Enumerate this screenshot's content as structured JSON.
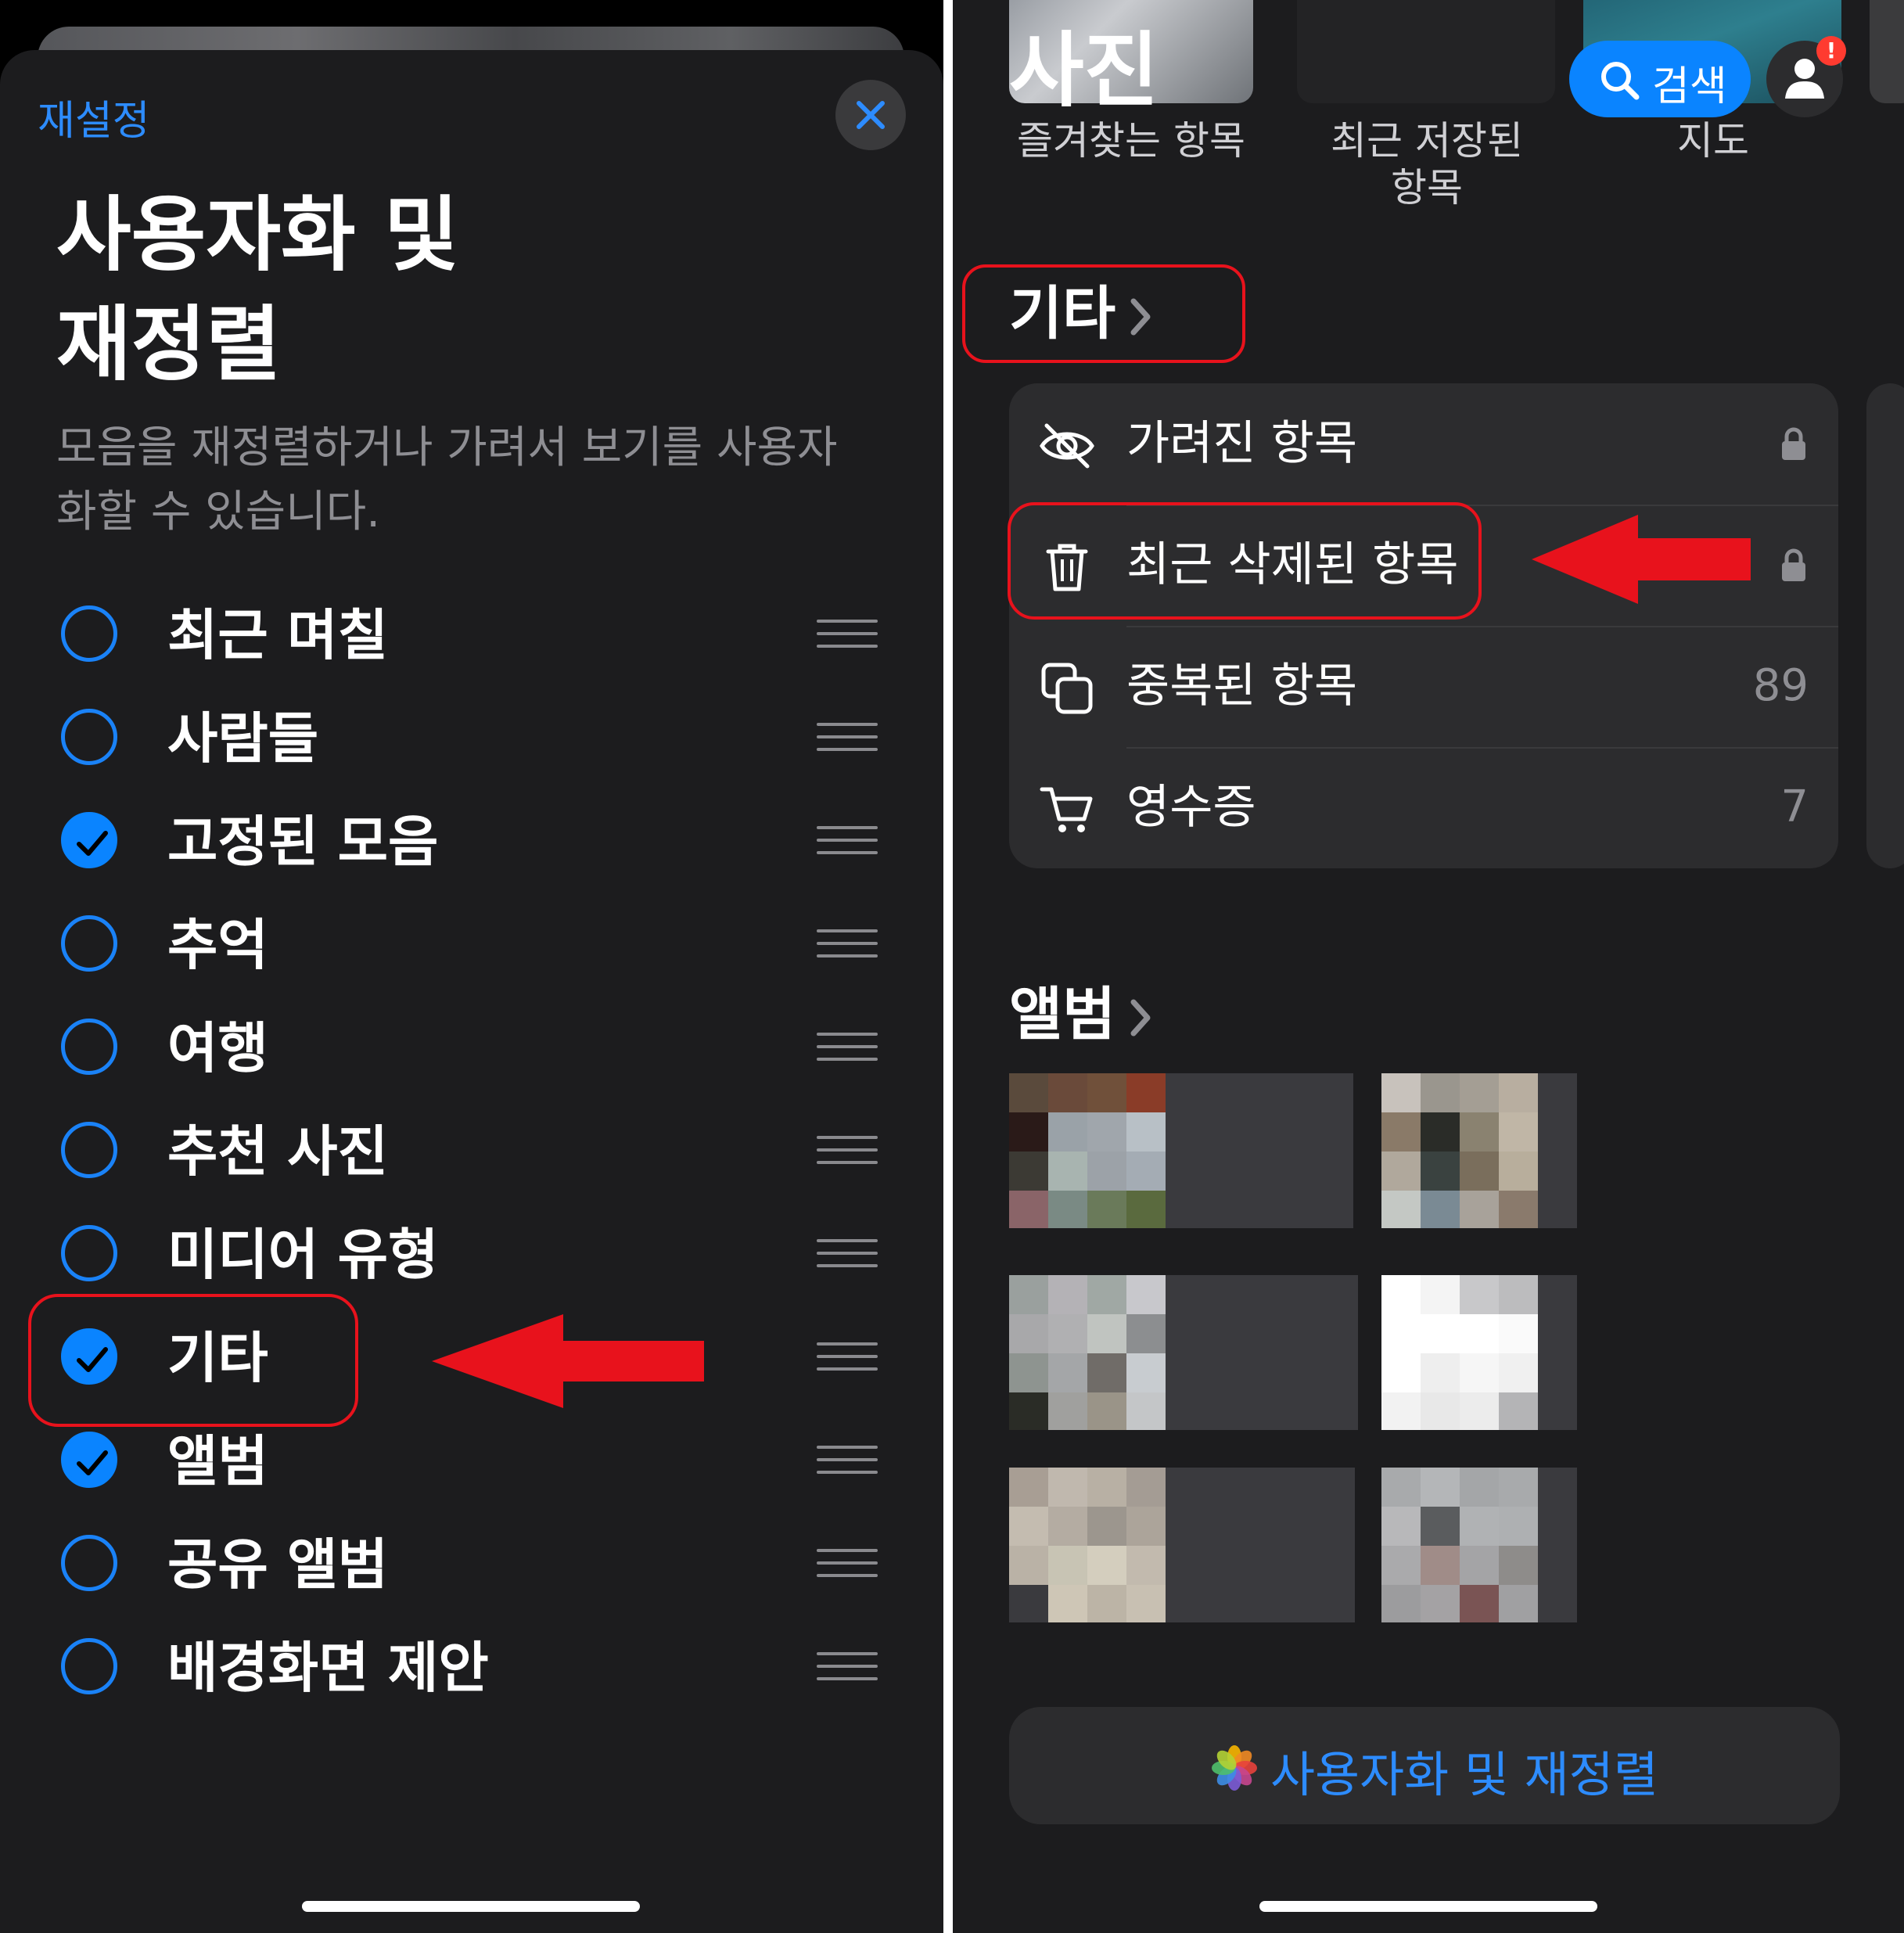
{
  "left": {
    "reset_label": "재설정",
    "close_icon": "close-icon",
    "title": "사용자화 및\n재정렬",
    "description": "모음을 재정렬하거나 가려서 보기를 사용자화할 수 있습니다.",
    "items": [
      {
        "label": "최근 며칠",
        "checked": false
      },
      {
        "label": "사람들",
        "checked": false
      },
      {
        "label": "고정된 모음",
        "checked": true
      },
      {
        "label": "추억",
        "checked": false
      },
      {
        "label": "여행",
        "checked": false
      },
      {
        "label": "추천 사진",
        "checked": false
      },
      {
        "label": "미디어 유형",
        "checked": false
      },
      {
        "label": "기타",
        "checked": true
      },
      {
        "label": "앨범",
        "checked": true
      },
      {
        "label": "공유 앨범",
        "checked": false
      },
      {
        "label": "배경화면 제안",
        "checked": false
      }
    ]
  },
  "right": {
    "app_title": "사진",
    "search_label": "검색",
    "badge": "!",
    "pinned": [
      {
        "label": "즐겨찾는 항목"
      },
      {
        "label": "최근 저장된\n항목"
      },
      {
        "label": "지도"
      }
    ],
    "other_header": "기타",
    "utilities": [
      {
        "label": "가려진 항목",
        "icon": "eye-slash-icon",
        "right": "",
        "locked": true
      },
      {
        "label": "최근 삭제된 항목",
        "icon": "trash-icon",
        "right": "",
        "locked": true
      },
      {
        "label": "중복된 항목",
        "icon": "duplicate-icon",
        "right": "89",
        "locked": false
      },
      {
        "label": "영수증",
        "icon": "cart-icon",
        "right": "7",
        "locked": false
      }
    ],
    "albums_header": "앨범",
    "customize_label": "사용자화 및 재정렬"
  },
  "colors": {
    "accent": "#0a84ff",
    "highlight": "#e8121c",
    "background": "#1c1c1e",
    "card": "#2c2c2e"
  }
}
